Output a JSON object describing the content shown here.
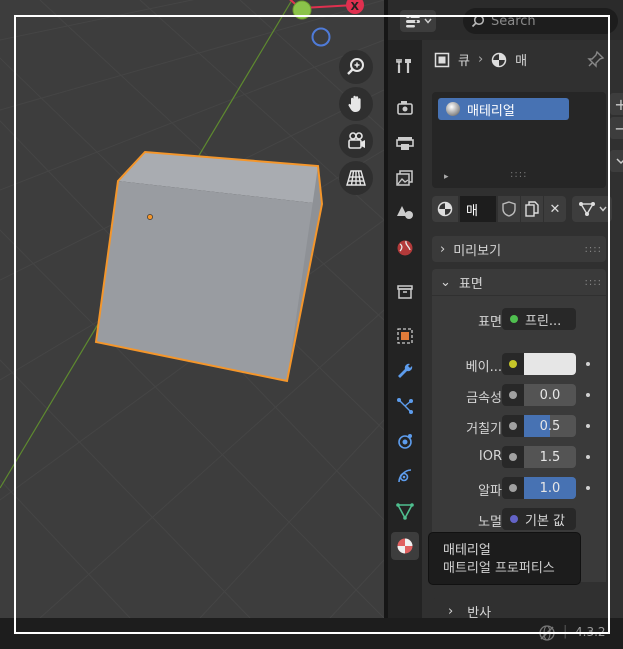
{
  "viewport": {
    "gizmo_x_label": "X",
    "nav_icons": [
      "zoom-icon",
      "hand-pan-icon",
      "camera-icon",
      "perspective-grid-icon"
    ]
  },
  "header": {
    "search_placeholder": "Search"
  },
  "breadcrumb": {
    "object": "큐",
    "separator": "›",
    "material": "매"
  },
  "material_list": {
    "items": [
      {
        "label": "매테리얼",
        "selected": true
      }
    ],
    "grip": "::::",
    "expand": "▸"
  },
  "slot": {
    "name": "매",
    "close": "✕"
  },
  "panels": {
    "preview": {
      "label": "미리보기",
      "collapsed": true,
      "arrow": "›",
      "grip": "::::"
    },
    "surface": {
      "label": "표면",
      "collapsed": false,
      "arrow": "⌄",
      "grip": "::::"
    },
    "reflection": {
      "label": "반사",
      "collapsed": true,
      "arrow": "›"
    }
  },
  "surface_props": {
    "surface": {
      "label": "표면",
      "value": "프린...",
      "socket_color": "#4fbf4f"
    },
    "base": {
      "label": "베이...",
      "socket_color": "#c7c729",
      "color": "#e6e6e6"
    },
    "metallic": {
      "label": "금속성",
      "value": "0.0",
      "fraction": 0.0,
      "socket_color": "#a1a1a1"
    },
    "roughness": {
      "label": "거칠기",
      "value": "0.5",
      "fraction": 0.5,
      "socket_color": "#a1a1a1"
    },
    "ior": {
      "label": "IOR",
      "value": "1.5",
      "fraction": 0.0,
      "socket_color": "#a1a1a1"
    },
    "alpha": {
      "label": "알파",
      "value": "1.0",
      "fraction": 1.0,
      "socket_color": "#a1a1a1"
    },
    "normal": {
      "label": "노멀",
      "value": "기본 값",
      "socket_color": "#6363c7"
    }
  },
  "tooltip": {
    "title": "매테리얼",
    "description": "매트리얼 프로퍼티스"
  },
  "status": {
    "version": "4.3.2"
  },
  "colors": {
    "accent": "#4772b3",
    "selection_outline": "#f4962b",
    "viewport_bg": "#3d3d3d"
  }
}
